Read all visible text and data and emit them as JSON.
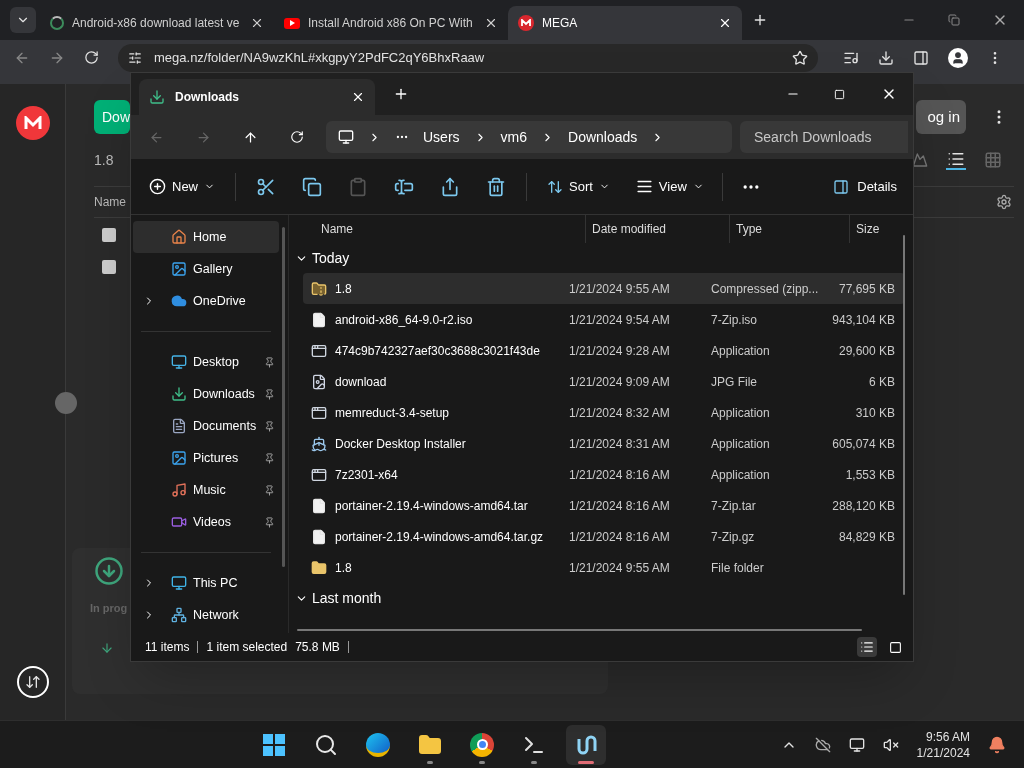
{
  "browser": {
    "tabs": [
      {
        "kind": "loading",
        "title": "Android-x86 download latest ve",
        "selected": false
      },
      {
        "kind": "video",
        "title": "Install Android x86 On PC With",
        "selected": false
      },
      {
        "kind": "mega",
        "title": "MEGA",
        "selected": true
      }
    ],
    "url": "mega.nz/folder/NA9wzKhL#xkgpyY2PdFC2qY6BhxRaaw"
  },
  "mega_page": {
    "download_button": "Dow",
    "folder_name": "1.8",
    "name_column": "Name",
    "login_button": "og in",
    "transfers_status": "In prog"
  },
  "explorer": {
    "tab_title": "Downloads",
    "breadcrumb": [
      "Users",
      "vm6",
      "Downloads"
    ],
    "search_placeholder": "Search Downloads",
    "new_button": "New",
    "edit_buttons": [
      {
        "disabled": false
      },
      {
        "disabled": false
      },
      {
        "disabled": true
      },
      {
        "disabled": false
      },
      {
        "disabled": false
      },
      {
        "disabled": false
      }
    ],
    "sort_button": "Sort",
    "view_button": "View",
    "details_button": "Details",
    "nav_groups": [
      [
        {
          "kind": "home",
          "label": "Home",
          "selected": true,
          "expandable": false,
          "pinned": false
        },
        {
          "kind": "gallery",
          "label": "Gallery",
          "selected": false,
          "expandable": false,
          "pinned": false
        },
        {
          "kind": "cloud",
          "label": "OneDrive",
          "selected": false,
          "expandable": true,
          "pinned": false
        }
      ],
      [
        {
          "kind": "desktop",
          "label": "Desktop",
          "selected": false,
          "expandable": false,
          "pinned": true
        },
        {
          "kind": "downloads",
          "label": "Downloads",
          "selected": false,
          "expandable": false,
          "pinned": true
        },
        {
          "kind": "documents",
          "label": "Documents",
          "selected": false,
          "expandable": false,
          "pinned": true
        },
        {
          "kind": "pictures",
          "label": "Pictures",
          "selected": false,
          "expandable": false,
          "pinned": true
        },
        {
          "kind": "music",
          "label": "Music",
          "selected": false,
          "expandable": false,
          "pinned": true
        },
        {
          "kind": "videos",
          "label": "Videos",
          "selected": false,
          "expandable": false,
          "pinned": true
        }
      ],
      [
        {
          "kind": "pc",
          "label": "This PC",
          "selected": false,
          "expandable": true,
          "pinned": false
        },
        {
          "kind": "network",
          "label": "Network",
          "selected": false,
          "expandable": true,
          "pinned": false
        }
      ]
    ],
    "columns": [
      "Name",
      "Date modified",
      "Type",
      "Size"
    ],
    "groups": [
      {
        "label": "Today",
        "expanded": true,
        "rows": [
          {
            "kind": "zip",
            "name": "1.8",
            "date": "1/21/2024 9:55 AM",
            "type": "Compressed (zipp...",
            "size": "77,695 KB",
            "selected": true
          },
          {
            "kind": "file",
            "name": "android-x86_64-9.0-r2.iso",
            "date": "1/21/2024 9:54 AM",
            "type": "7-Zip.iso",
            "size": "943,104 KB",
            "selected": false
          },
          {
            "kind": "app",
            "name": "474c9b742327aef30c3688c3021f43de",
            "date": "1/21/2024 9:28 AM",
            "type": "Application",
            "size": "29,600 KB",
            "selected": false
          },
          {
            "kind": "image",
            "name": "download",
            "date": "1/21/2024 9:09 AM",
            "type": "JPG File",
            "size": "6 KB",
            "selected": false
          },
          {
            "kind": "app",
            "name": "memreduct-3.4-setup",
            "date": "1/21/2024 8:32 AM",
            "type": "Application",
            "size": "310 KB",
            "selected": false
          },
          {
            "kind": "whale",
            "name": "Docker Desktop Installer",
            "date": "1/21/2024 8:31 AM",
            "type": "Application",
            "size": "605,074 KB",
            "selected": false
          },
          {
            "kind": "app",
            "name": "7z2301-x64",
            "date": "1/21/2024 8:16 AM",
            "type": "Application",
            "size": "1,553 KB",
            "selected": false
          },
          {
            "kind": "file",
            "name": "portainer-2.19.4-windows-amd64.tar",
            "date": "1/21/2024 8:16 AM",
            "type": "7-Zip.tar",
            "size": "288,120 KB",
            "selected": false
          },
          {
            "kind": "file",
            "name": "portainer-2.19.4-windows-amd64.tar.gz",
            "date": "1/21/2024 8:16 AM",
            "type": "7-Zip.gz",
            "size": "84,829 KB",
            "selected": false
          },
          {
            "kind": "folder",
            "name": "1.8",
            "date": "1/21/2024 9:55 AM",
            "type": "File folder",
            "selected": false
          }
        ]
      },
      {
        "label": "Last month",
        "expanded": true
      }
    ],
    "status": [
      "11 items",
      "1 item selected",
      "75.8 MB"
    ],
    "view_modes": [
      {
        "selected": true
      },
      {
        "selected": false
      }
    ]
  },
  "taskbar": {
    "apps": [
      {
        "kind": "start",
        "running": false,
        "active": false
      },
      {
        "kind": "search",
        "running": false,
        "active": false
      },
      {
        "kind": "browser-pre",
        "running": false,
        "active": false
      },
      {
        "kind": "folder",
        "running": true,
        "active": false
      },
      {
        "kind": "chrome",
        "running": true,
        "active": false
      },
      {
        "kind": "terminal",
        "running": true,
        "active": false
      },
      {
        "kind": "app",
        "running": true,
        "active": true
      }
    ],
    "time": "9:56 AM",
    "date": "1/21/2024"
  }
}
